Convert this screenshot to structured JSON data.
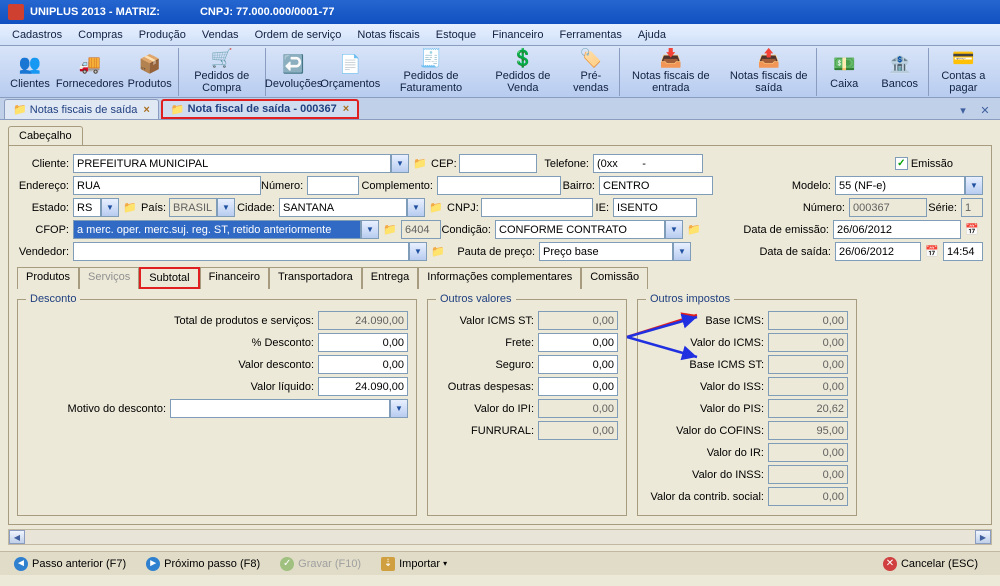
{
  "title": {
    "app": "UNIPLUS  2013 - MATRIZ:",
    "cnpj_label": "CNPJ: 77.000.000/0001-77"
  },
  "menu": [
    "Cadastros",
    "Compras",
    "Produção",
    "Vendas",
    "Ordem de serviço",
    "Notas fiscais",
    "Estoque",
    "Financeiro",
    "Ferramentas",
    "Ajuda"
  ],
  "toolbar": [
    "Clientes",
    "Fornecedores",
    "Produtos",
    "Pedidos de Compra",
    "Devoluções",
    "Orçamentos",
    "Pedidos de Faturamento",
    "Pedidos de Venda",
    "Pré-vendas",
    "Notas fiscais de entrada",
    "Notas fiscais de saída",
    "Caixa",
    "Bancos",
    "Contas a pagar"
  ],
  "tabs": [
    {
      "label": "Notas fiscais de saída"
    },
    {
      "label": "Nota fiscal de saída - 000367"
    }
  ],
  "headTab": "Cabeçalho",
  "fields": {
    "cliente_l": "Cliente:",
    "cliente": "PREFEITURA MUNICIPAL",
    "cep_l": "CEP:",
    "cep": "",
    "telefone_l": "Telefone:",
    "telefone": "(0xx        -",
    "emissao_l": "Emissão",
    "endereco_l": "Endereço:",
    "endereco": "RUA",
    "numero_l": "Número:",
    "numero": "",
    "complemento_l": "Complemento:",
    "complemento": "",
    "bairro_l": "Bairro:",
    "bairro": "CENTRO",
    "modelo_l": "Modelo:",
    "modelo": "55 (NF-e)",
    "estado_l": "Estado:",
    "estado": "RS",
    "pais_l": "País:",
    "pais": "BRASIL",
    "cidade_l": "Cidade:",
    "cidade": "SANTANA",
    "cnpj_l": "CNPJ:",
    "cnpj": "",
    "ie_l": "IE:",
    "ie": "ISENTO",
    "numero2_l": "Número:",
    "numero2": "000367",
    "serie_l": "Série:",
    "serie": "1",
    "cfop_l": "CFOP:",
    "cfop": "a merc. oper. merc.suj. reg. ST, retido anteriormente",
    "cfop_code": "6404",
    "condicao_l": "Condição:",
    "condicao": "CONFORME CONTRATO",
    "dataemissao_l": "Data de emissão:",
    "dataemissao": "26/06/2012",
    "vendedor_l": "Vendedor:",
    "vendedor": "",
    "pauta_l": "Pauta de preço:",
    "pauta": "Preço base",
    "datasaida_l": "Data de saída:",
    "datasaida": "26/06/2012",
    "horasaida": "14:54"
  },
  "subtabs": [
    "Produtos",
    "Serviços",
    "Subtotal",
    "Financeiro",
    "Transportadora",
    "Entrega",
    "Informações complementares",
    "Comissão"
  ],
  "desconto": {
    "legend": "Desconto",
    "total_l": "Total de produtos e serviços:",
    "total": "24.090,00",
    "pct_l": "% Desconto:",
    "pct": "0,00",
    "valor_l": "Valor desconto:",
    "valor": "0,00",
    "liquido_l": "Valor líquido:",
    "liquido": "24.090,00",
    "motivo_l": "Motivo do desconto:",
    "motivo": ""
  },
  "outrosvalores": {
    "legend": "Outros valores",
    "icmsst_l": "Valor ICMS ST:",
    "icmsst": "0,00",
    "frete_l": "Frete:",
    "frete": "0,00",
    "seguro_l": "Seguro:",
    "seguro": "0,00",
    "desp_l": "Outras despesas:",
    "desp": "0,00",
    "ipi_l": "Valor do IPI:",
    "ipi": "0,00",
    "funrural_l": "FUNRURAL:",
    "funrural": "0,00"
  },
  "outrosimpostos": {
    "legend": "Outros impostos",
    "baseicms_l": "Base ICMS:",
    "baseicms": "0,00",
    "valoricms_l": "Valor do ICMS:",
    "valoricms": "0,00",
    "baseicmsst_l": "Base ICMS ST:",
    "baseicmsst": "0,00",
    "iss_l": "Valor do ISS:",
    "iss": "0,00",
    "pis_l": "Valor do PIS:",
    "pis": "20,62",
    "cofins_l": "Valor do COFINS:",
    "cofins": "95,00",
    "ir_l": "Valor do IR:",
    "ir": "0,00",
    "inss_l": "Valor do INSS:",
    "inss": "0,00",
    "contrib_l": "Valor da contrib. social:",
    "contrib": "0,00"
  },
  "status": {
    "prev": "Passo anterior (F7)",
    "next": "Próximo passo (F8)",
    "save": "Gravar (F10)",
    "import": "Importar",
    "cancel": "Cancelar (ESC)"
  }
}
